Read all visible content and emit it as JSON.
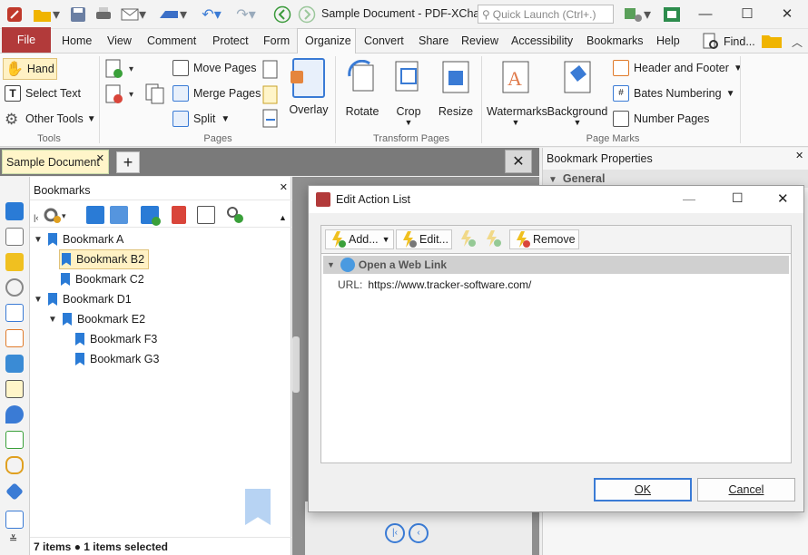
{
  "window": {
    "title": "Sample Document - PDF-XCha...",
    "quick_launch_placeholder": "Quick Launch (Ctrl+.)"
  },
  "menu": {
    "file": "File",
    "items": [
      "Home",
      "View",
      "Comment",
      "Protect",
      "Form",
      "Organize",
      "Convert",
      "Share",
      "Review",
      "Accessibility",
      "Bookmarks",
      "Help"
    ],
    "find": "Find..."
  },
  "ribbon": {
    "tools": {
      "hand": "Hand",
      "select_text": "Select Text",
      "other_tools": "Other Tools",
      "group": "Tools"
    },
    "pages": {
      "move": "Move Pages",
      "merge": "Merge Pages",
      "split": "Split",
      "overlay": "Overlay",
      "group": "Pages"
    },
    "transform": {
      "rotate": "Rotate",
      "crop": "Crop",
      "resize": "Resize",
      "group": "Transform Pages"
    },
    "marks": {
      "watermarks": "Watermarks",
      "background": "Background",
      "header_footer": "Header and Footer",
      "bates": "Bates Numbering",
      "page_numbers": "Number Pages",
      "group": "Page Marks"
    }
  },
  "doc_tab": {
    "label": "Sample Document"
  },
  "bookmarks_panel": {
    "title": "Bookmarks",
    "items": [
      {
        "label": "Bookmark A",
        "level": 0,
        "expanded": true
      },
      {
        "label": "Bookmark B2",
        "level": 1,
        "selected": true
      },
      {
        "label": "Bookmark C2",
        "level": 1
      },
      {
        "label": "Bookmark D1",
        "level": 0,
        "expanded": true
      },
      {
        "label": "Bookmark E2",
        "level": 1,
        "expanded": true
      },
      {
        "label": "Bookmark F3",
        "level": 2
      },
      {
        "label": "Bookmark G3",
        "level": 2
      }
    ],
    "status_count": "7 items",
    "status_selected": "1 items selected"
  },
  "properties": {
    "title": "Bookmark Properties",
    "section": "General"
  },
  "dialog": {
    "title": "Edit Action List",
    "add": "Add...",
    "edit": "Edit...",
    "remove": "Remove",
    "action_header": "Open a Web Link",
    "url_label": "URL:",
    "url_value": "https://www.tracker-software.com/",
    "ok": "OK",
    "cancel": "Cancel"
  },
  "colors": {
    "accent": "#2a7bd6",
    "file_tab": "#b23a3a",
    "selected_row": "#fff1c4"
  }
}
